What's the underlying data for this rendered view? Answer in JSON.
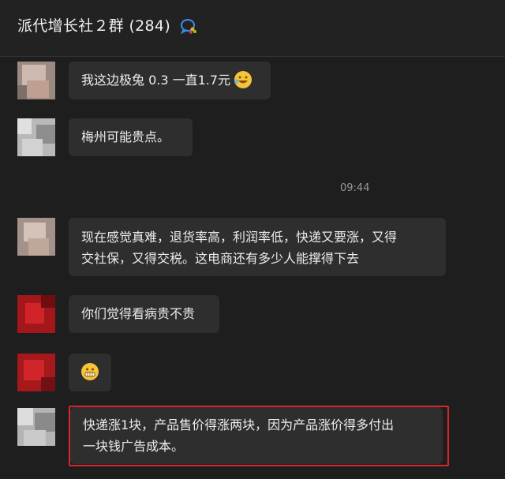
{
  "header": {
    "title": "派代增长社２群 (284)",
    "icon": "group-chat-icon"
  },
  "messages": [
    {
      "text": "我这边极兔 0.3 一直1.7元",
      "emoji": "laughing-crying-emoji"
    },
    {
      "text": "梅州可能贵点。"
    },
    {
      "text": "现在感觉真难，退货率高，利润率低，快递又要涨，又得",
      "text2": "交社保，又得交税。这电商还有多少人能撑得下去"
    },
    {
      "text": "你们觉得看病贵不贵"
    },
    {
      "emoji": "grinning-grimace-emoji"
    },
    {
      "text": "快递涨1块，产品售价得涨两块，因为产品涨价得多付出",
      "text2": "一块钱广告成本。"
    }
  ],
  "timestamp": "09:44",
  "colors": {
    "highlight": "#d5262c",
    "bubble": "#2e2e2e",
    "background": "#1e1e1e"
  }
}
